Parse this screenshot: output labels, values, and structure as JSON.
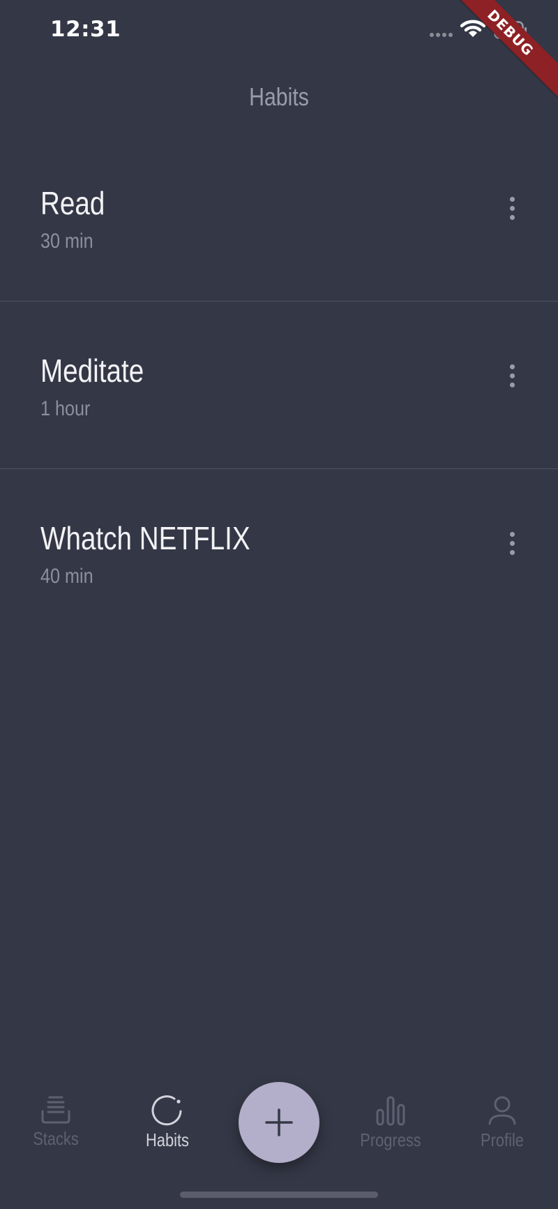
{
  "status_bar": {
    "time": "12:31",
    "debug_label": "DEBUG"
  },
  "header": {
    "title": "Habits"
  },
  "habits": [
    {
      "name": "Read",
      "duration": "30 min"
    },
    {
      "name": "Meditate",
      "duration": "1 hour"
    },
    {
      "name": "Whatch NETFLIX",
      "duration": "40 min"
    }
  ],
  "bottom_nav": {
    "items": [
      {
        "label": "Stacks",
        "icon": "stacks-icon",
        "active": false
      },
      {
        "label": "Habits",
        "icon": "habits-icon",
        "active": true
      },
      {
        "label": "Progress",
        "icon": "progress-icon",
        "active": false
      },
      {
        "label": "Profile",
        "icon": "profile-icon",
        "active": false
      }
    ],
    "fab_icon": "plus-icon"
  },
  "colors": {
    "background": "#343846",
    "fab": "#b3aec9",
    "debug_banner": "#8e2125",
    "active_nav": "#d2d3dd",
    "inactive_nav": "#5d6172"
  }
}
